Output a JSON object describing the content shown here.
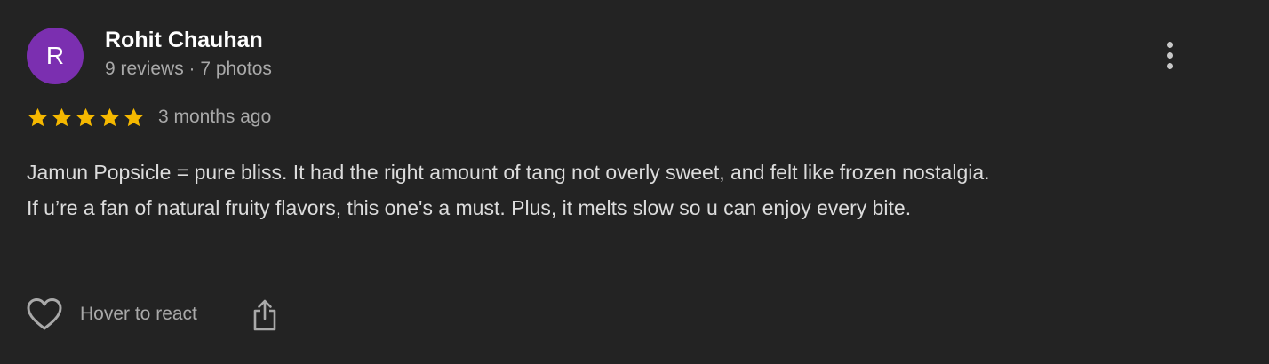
{
  "author": {
    "initial": "R",
    "name": "Rohit Chauhan",
    "meta": "9 reviews · 7 photos",
    "avatar_color": "#7b2fb0"
  },
  "rating": {
    "stars": 5,
    "max": 5,
    "date": "3 months ago",
    "star_color": "#f5b800"
  },
  "review": {
    "line1": "Jamun Popsicle = pure bliss. It had the right amount of tang not overly sweet, and felt like frozen nostalgia.",
    "line2": "If u’re a fan of natural fruity flavors, this one's a must. Plus, it melts slow so u can enjoy every bite."
  },
  "actions": {
    "react_label": "Hover to react",
    "react_icon": "heart-icon",
    "share_icon": "share-icon",
    "menu_icon": "more-vertical-icon"
  }
}
